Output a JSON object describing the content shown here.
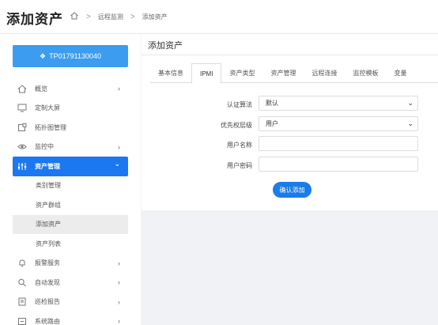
{
  "header": {
    "title": "添加资产",
    "breadcrumb": [
      "远程监测",
      "添加资产"
    ]
  },
  "sidebar": {
    "device_label": "TP01791130040",
    "items": [
      {
        "label": "概览",
        "icon": "home-icon",
        "chevron": "›"
      },
      {
        "label": "定制大屏",
        "icon": "monitor-icon"
      },
      {
        "label": "拓扑图管理",
        "icon": "topology-icon"
      },
      {
        "label": "监控中",
        "icon": "eye-icon",
        "chevron": "›"
      },
      {
        "label": "资产管理",
        "icon": "sliders-icon",
        "chevron": "⌄",
        "active": true
      },
      {
        "label": "报警服务",
        "icon": "bell-icon",
        "chevron": "›"
      },
      {
        "label": "自动发现",
        "icon": "search-icon",
        "chevron": "›"
      },
      {
        "label": "巡检报告",
        "icon": "report-icon",
        "chevron": "›"
      },
      {
        "label": "系统路由",
        "icon": "route-icon",
        "chevron": "›"
      }
    ],
    "sub_items": [
      "类别管理",
      "资产群组",
      "添加资产",
      "资产列表"
    ],
    "selected_sub": "添加资产"
  },
  "panel": {
    "title": "添加资产",
    "tabs": [
      "基本信息",
      "IPMI",
      "资产类型",
      "资产管理",
      "远程连接",
      "监控模板",
      "变量"
    ],
    "active_tab": "IPMI"
  },
  "form": {
    "auth_label": "认证算法",
    "auth_value": "默认",
    "priv_label": "优先权层级",
    "priv_value": "用户",
    "user_label": "用户名称",
    "user_value": "",
    "pass_label": "用户密码",
    "pass_value": "",
    "submit_label": "确认添加"
  },
  "colors": {
    "accent": "#1c78f0",
    "device_button": "#3c9cf0",
    "selected_sub_bg": "#ececec"
  }
}
